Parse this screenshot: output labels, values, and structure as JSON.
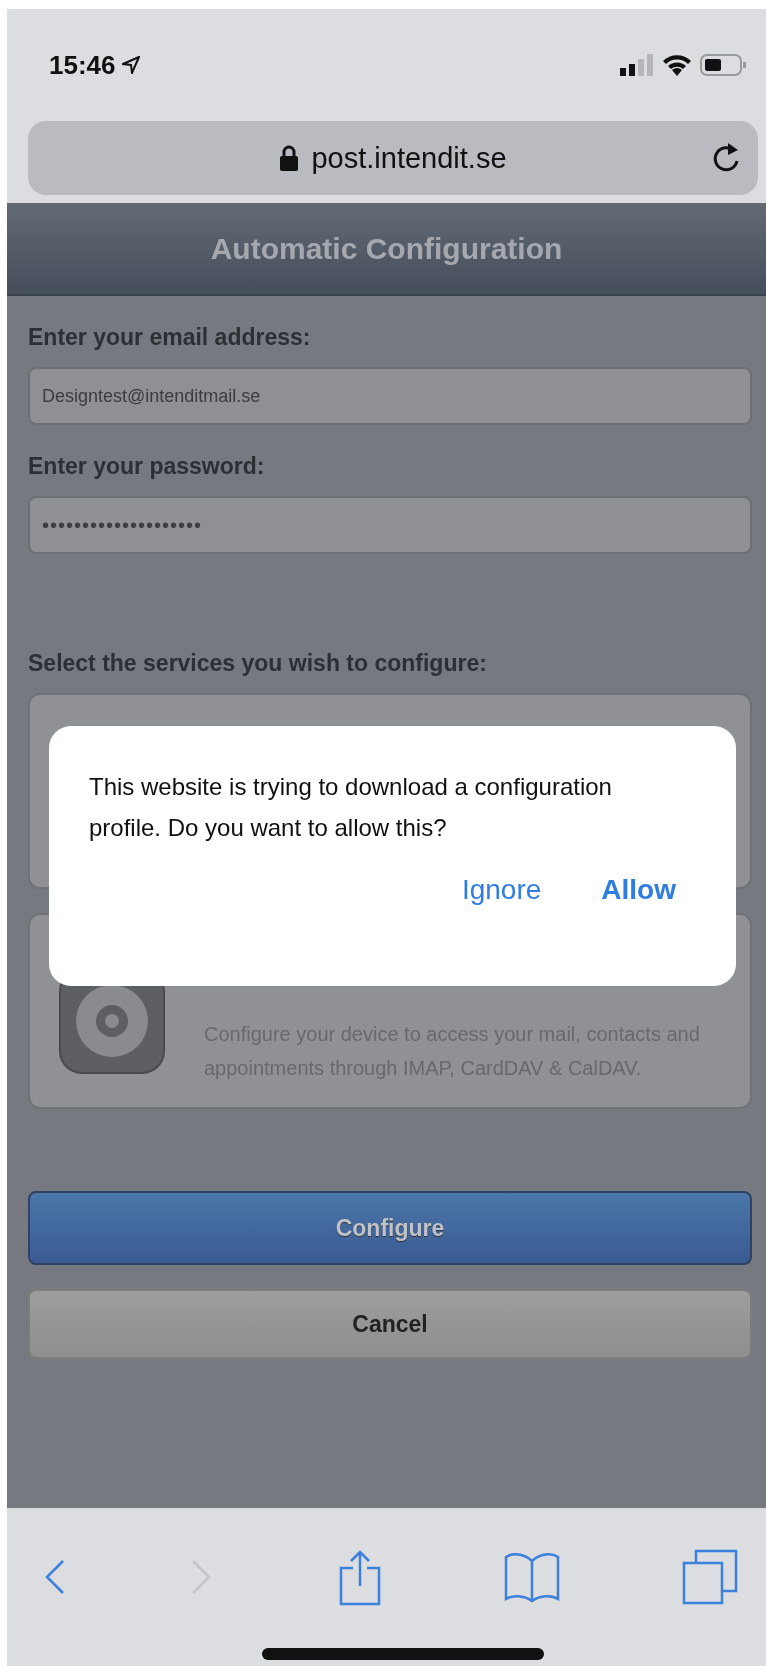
{
  "status_bar": {
    "time": "15:46"
  },
  "address_bar": {
    "url": "post.intendit.se"
  },
  "header": {
    "title": "Automatic Configuration"
  },
  "fields": [
    {
      "label": "Enter your email address:",
      "value": "Designtest@intenditmail.se"
    },
    {
      "label": "Enter your password:",
      "value": "••••••••••••••••••••"
    }
  ],
  "services": {
    "label": "Select the services you wish to configure:",
    "items": [
      {
        "kind": "covered"
      },
      {
        "kind": "profile",
        "description": "Configure your device to access your mail, contacts and appointments through IMAP, CardDAV & CalDAV."
      }
    ]
  },
  "buttons": [
    {
      "label": "Configure",
      "kind": "primary"
    },
    {
      "label": "Cancel",
      "kind": "secondary"
    }
  ],
  "dialog": {
    "message": "This website is trying to download a configuration profile. Do you want to allow this?",
    "actions": [
      {
        "label": "Ignore",
        "kind": "secondary"
      },
      {
        "label": "Allow",
        "kind": "primary"
      }
    ]
  },
  "toolbar": [
    {
      "kind": "back",
      "disabled": false
    },
    {
      "kind": "forward",
      "disabled": true
    },
    {
      "kind": "share",
      "disabled": false
    },
    {
      "kind": "bookmarks",
      "disabled": false
    },
    {
      "kind": "tabs",
      "disabled": false
    }
  ]
}
